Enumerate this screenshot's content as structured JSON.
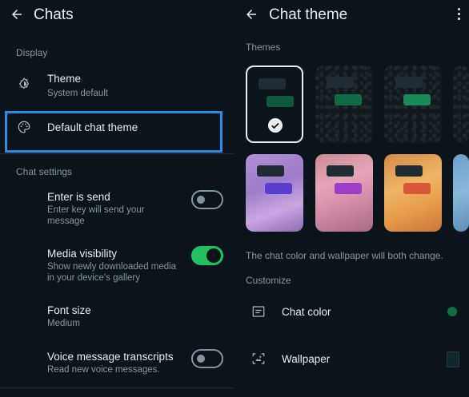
{
  "left": {
    "title": "Chats",
    "sections": {
      "display": "Display",
      "chat_settings": "Chat settings"
    },
    "theme": {
      "title": "Theme",
      "subtitle": "System default"
    },
    "default_chat_theme": {
      "title": "Default chat theme"
    },
    "enter_is_send": {
      "title": "Enter is send",
      "subtitle_line1": "Enter key will send your",
      "subtitle_line2": "message",
      "enabled": false
    },
    "media_visibility": {
      "title": "Media visibility",
      "subtitle_line1": "Show newly downloaded media",
      "subtitle_line2": "in your device's gallery",
      "enabled": true
    },
    "font_size": {
      "title": "Font size",
      "subtitle": "Medium"
    },
    "voice_transcripts": {
      "title": "Voice message transcripts",
      "subtitle": "Read new voice messages.",
      "enabled": false
    }
  },
  "right": {
    "title": "Chat theme",
    "themes_header": "Themes",
    "caption": "The chat color and wallpaper will both change.",
    "customize_header": "Customize",
    "chat_color": "Chat color",
    "wallpaper": "Wallpaper",
    "tiles": [
      {
        "style": "dark",
        "outgoing_color": "#0f5a3c",
        "selected": true
      },
      {
        "style": "dark-textured",
        "outgoing_color": "#0f6b42",
        "selected": false
      },
      {
        "style": "dark-textured",
        "outgoing_color": "#178a55",
        "selected": false
      },
      {
        "style": "purple",
        "outgoing_color": "#5a3ecf",
        "selected": false
      },
      {
        "style": "pink",
        "outgoing_color": "#9b3fc9",
        "selected": false
      },
      {
        "style": "orange",
        "outgoing_color": "#d9573a",
        "selected": false
      },
      {
        "style": "blue",
        "outgoing_color": "#3a8fd9",
        "selected": false
      }
    ]
  },
  "colors": {
    "background": "#0b141a",
    "accent_green": "#21c063",
    "highlight_blue": "#2b8ce8",
    "muted_text": "#8696a0"
  },
  "icons": {
    "back": "arrow-left-icon",
    "theme": "brightness-icon",
    "palette": "palette-icon",
    "menu": "more-vertical-icon",
    "chat_color": "chat-color-icon",
    "wallpaper": "wallpaper-icon",
    "check": "check-circle-icon"
  }
}
